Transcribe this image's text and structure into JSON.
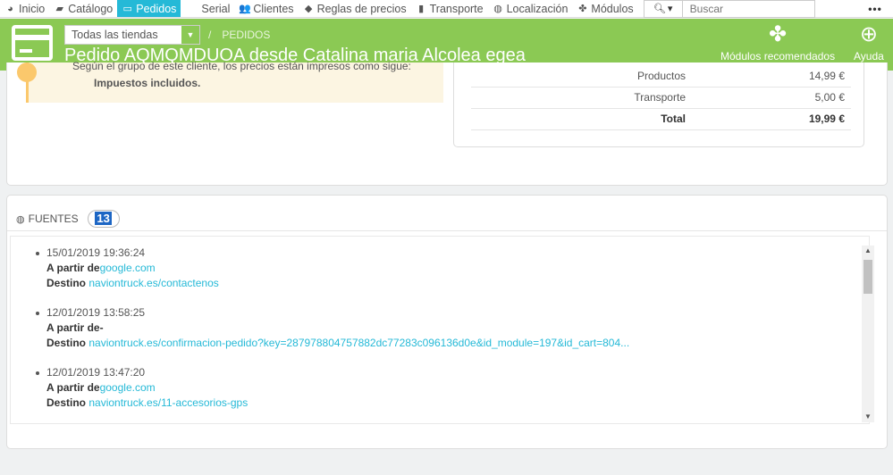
{
  "nav": {
    "items": [
      {
        "label": "Inicio",
        "icon": "dashboard-icon",
        "active": false
      },
      {
        "label": "Catálogo",
        "icon": "book-icon",
        "active": false
      },
      {
        "label": "Pedidos",
        "icon": "credit-card-icon",
        "active": true
      },
      {
        "label": "Serial",
        "icon": "",
        "active": false
      },
      {
        "label": "Clientes",
        "icon": "users-icon",
        "active": false
      },
      {
        "label": "Reglas de precios",
        "icon": "tag-icon",
        "active": false
      },
      {
        "label": "Transporte",
        "icon": "truck-icon",
        "active": false
      },
      {
        "label": "Localización",
        "icon": "globe-icon",
        "active": false
      },
      {
        "label": "Módulos",
        "icon": "puzzle-icon",
        "active": false
      }
    ],
    "search_placeholder": "Buscar",
    "more_label": "•••"
  },
  "header": {
    "shop_selector": "Todas las tiendas",
    "breadcrumb": "PEDIDOS",
    "title": "Pedido AQMQMDUOA desde Catalina maria Alcolea egea",
    "recommended_modules": "Módulos recomendados",
    "help": "Ayuda"
  },
  "warning": {
    "line1": "Según el grupo de este cliente, los precios están impresos como sigue:",
    "line2": "Impuestos incluidos."
  },
  "totals": [
    {
      "label": "Productos",
      "value": "14,99 €"
    },
    {
      "label": "Transporte",
      "value": "5,00 €"
    },
    {
      "label": "Total",
      "value": "19,99 €"
    }
  ],
  "sources_panel": {
    "title": "Fuentes",
    "count": "13",
    "entries": [
      {
        "date": "15/01/2019 19:36:24",
        "from_label": "A partir de",
        "from": "google.com",
        "dest_label": "Destino",
        "dest": "naviontruck.es/contactenos"
      },
      {
        "date": "12/01/2019 13:58:25",
        "from_label": "A partir de",
        "from": "-",
        "dest_label": "Destino",
        "dest": "naviontruck.es/confirmacion-pedido?key=287978804757882dc77283c096136d0e&id_module=197&id_cart=804..."
      },
      {
        "date": "12/01/2019 13:47:20",
        "from_label": "A partir de",
        "from": "google.com",
        "dest_label": "Destino",
        "dest": "naviontruck.es/11-accesorios-gps"
      },
      {
        "date": "",
        "from_label": "",
        "from": "",
        "dest_label": "",
        "dest": ""
      }
    ]
  }
}
